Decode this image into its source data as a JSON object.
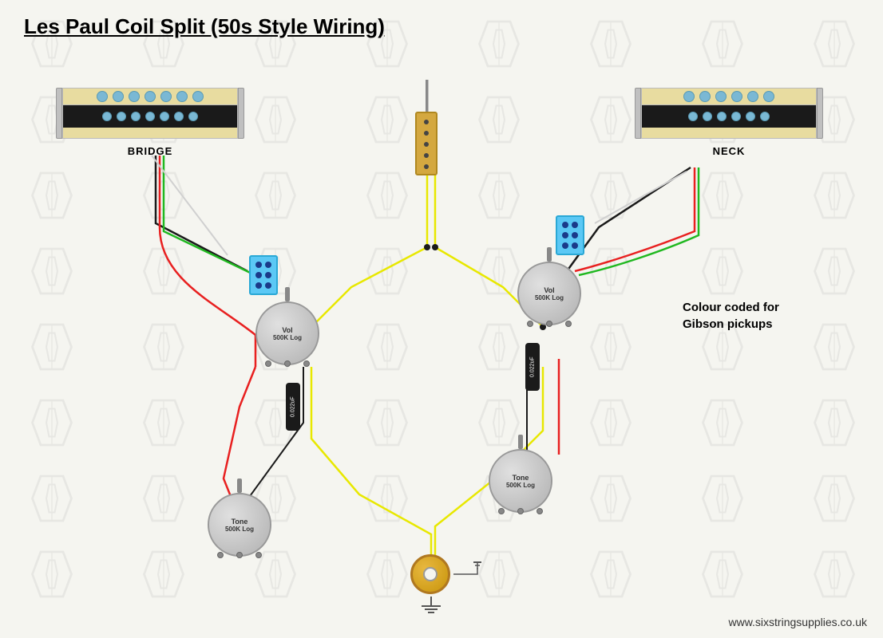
{
  "title": "Les Paul Coil Split (50s Style Wiring)",
  "bridge_label": "BRIDGE",
  "neck_label": "NECK",
  "vol_label": "Vol\n500K Log",
  "tone_label": "Tone\n500K Log",
  "cap_label": "0.022uF",
  "colour_coded": "Colour coded for\nGibson pickups",
  "website": "www.sixstringsupplies.co.uk",
  "accent_color": "#f5c518",
  "wires": {
    "yellow": "#e8e800",
    "red": "#e82020",
    "green": "#20b820",
    "black": "#1a1a1a",
    "white": "#f0f0f0"
  },
  "watermark_count": 40
}
